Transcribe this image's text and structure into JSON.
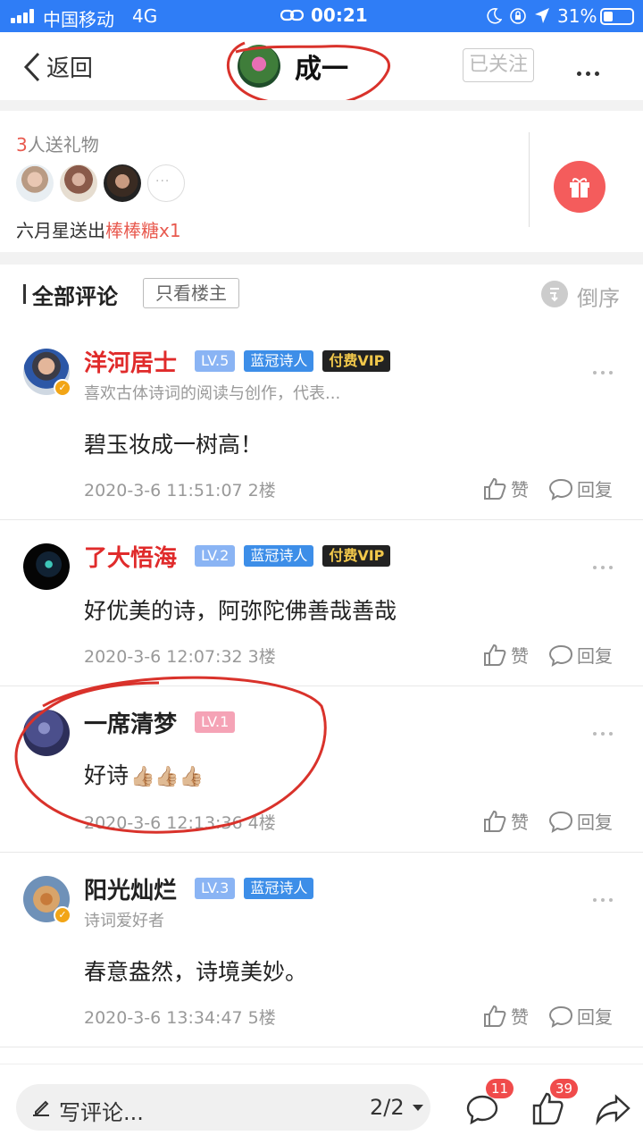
{
  "status_bar": {
    "carrier": "中国移动",
    "network": "4G",
    "time": "00:21",
    "battery_pct": "31%",
    "signal_bars": 4,
    "battery_level": 0.31
  },
  "nav": {
    "back_label": "返回",
    "title": "成一",
    "follow_label": "已关注"
  },
  "gifts": {
    "count": "3",
    "count_suffix": "人送礼物",
    "sender": "六月星送出",
    "item": "棒棒糖",
    "qty": "x1",
    "more_avatars": "···"
  },
  "comments_header": {
    "title": "全部评论",
    "only_author": "只看楼主",
    "sort": "倒序"
  },
  "comments": [
    {
      "name": "洋河居士",
      "level": "LV.5",
      "badge": "蓝冠诗人",
      "vip": "付费VIP",
      "bio": "喜欢古体诗词的阅读与创作，代表...",
      "text": "碧玉妆成一树高！",
      "time": "2020-3-6 11:51:07",
      "floor": "2楼",
      "like": "赞",
      "reply": "回复"
    },
    {
      "name": "了大悟海",
      "level": "LV.2",
      "badge": "蓝冠诗人",
      "vip": "付费VIP",
      "text": "好优美的诗，阿弥陀佛善哉善哉",
      "time": "2020-3-6 12:07:32",
      "floor": "3楼",
      "like": "赞",
      "reply": "回复"
    },
    {
      "name": "一席清梦",
      "level": "LV.1",
      "text": "好诗",
      "emoji": "👍🏼👍🏼👍🏼",
      "time": "2020-3-6 12:13:36",
      "floor": "4楼",
      "like": "赞",
      "reply": "回复"
    },
    {
      "name": "阳光灿烂",
      "level": "LV.3",
      "badge": "蓝冠诗人",
      "bio": "诗词爱好者",
      "text": "春意盎然，诗境美妙。",
      "time": "2020-3-6 13:34:47",
      "floor": "5楼",
      "like": "赞",
      "reply": "回复"
    }
  ],
  "bottom": {
    "placeholder": "写评论...",
    "page": "2/2",
    "comment_count": "11",
    "like_count": "39"
  },
  "colors": {
    "status_bar": "#2f7df6",
    "red_accent": "#e85a4f",
    "annotation": "#d9322b"
  }
}
